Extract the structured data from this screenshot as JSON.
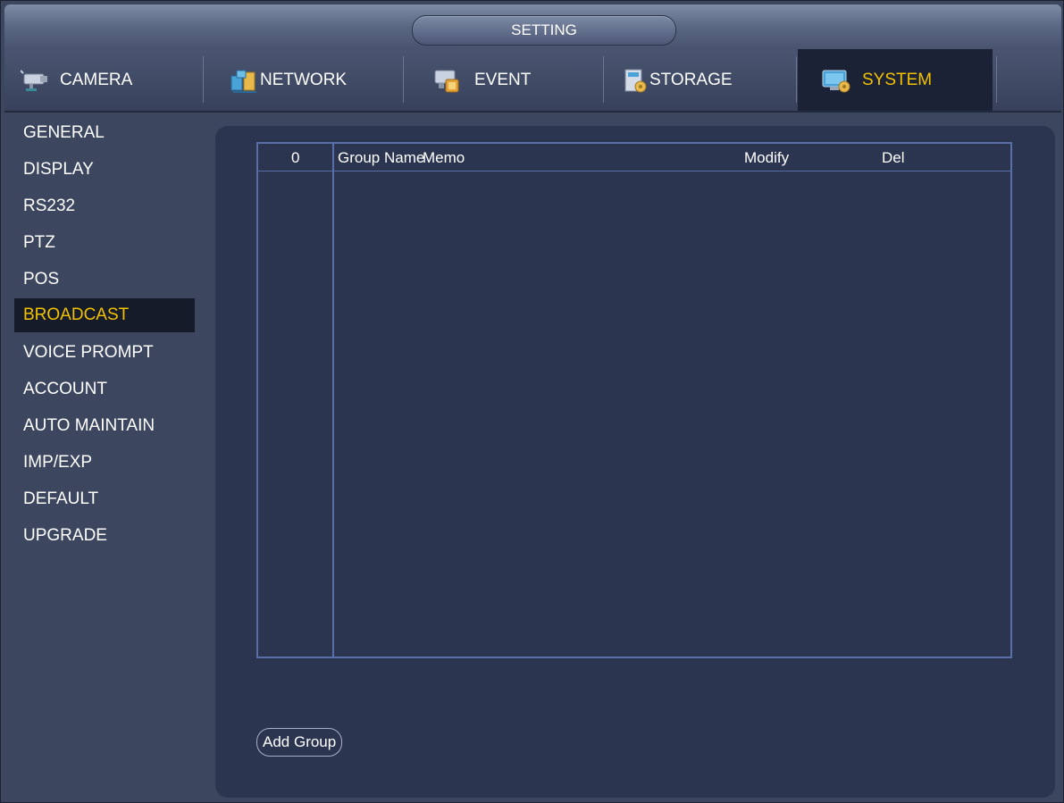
{
  "title": "SETTING",
  "tabs": [
    {
      "label": "CAMERA",
      "icon": "camera-icon"
    },
    {
      "label": "NETWORK",
      "icon": "network-icon"
    },
    {
      "label": "EVENT",
      "icon": "event-icon"
    },
    {
      "label": "STORAGE",
      "icon": "storage-icon"
    },
    {
      "label": "SYSTEM",
      "icon": "system-icon",
      "active": true
    }
  ],
  "sidebar": {
    "items": [
      {
        "label": "GENERAL"
      },
      {
        "label": "DISPLAY"
      },
      {
        "label": "RS232"
      },
      {
        "label": "PTZ"
      },
      {
        "label": "POS"
      },
      {
        "label": "BROADCAST",
        "active": true
      },
      {
        "label": "VOICE PROMPT"
      },
      {
        "label": "ACCOUNT"
      },
      {
        "label": "AUTO MAINTAIN"
      },
      {
        "label": "IMP/EXP"
      },
      {
        "label": "DEFAULT"
      },
      {
        "label": "UPGRADE"
      }
    ]
  },
  "table": {
    "columns": [
      "0",
      "Group Name",
      "Memo",
      "Modify",
      "Del"
    ],
    "rows": []
  },
  "buttons": {
    "add_group": "Add Group"
  },
  "colors": {
    "accent": "#f2c200",
    "background": "#3c465f",
    "panel": "#2c3550",
    "table_border": "#5a6fa8"
  }
}
